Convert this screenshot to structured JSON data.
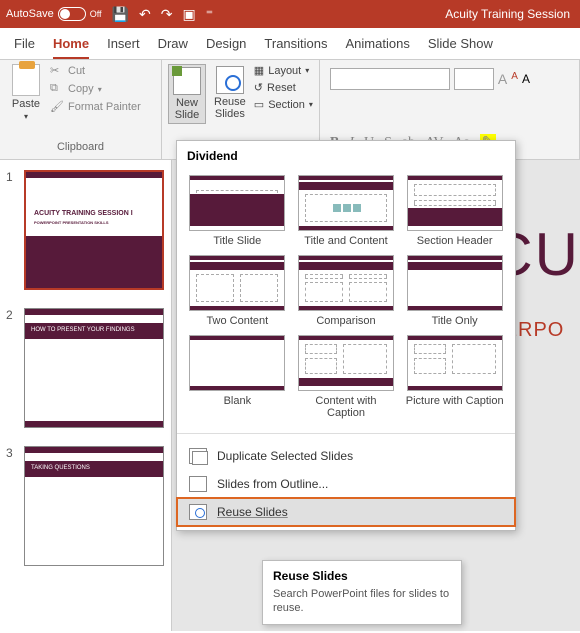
{
  "titlebar": {
    "autosave_label": "AutoSave",
    "autosave_state": "Off",
    "document_title": "Acuity Training Session"
  },
  "tabs": [
    "File",
    "Home",
    "Insert",
    "Draw",
    "Design",
    "Transitions",
    "Animations",
    "Slide Show"
  ],
  "active_tab": "Home",
  "ribbon": {
    "clipboard": {
      "paste": "Paste",
      "cut": "Cut",
      "copy": "Copy",
      "format_painter": "Format Painter",
      "group_label": "Clipboard"
    },
    "slides": {
      "new_slide": "New\nSlide",
      "reuse_slides": "Reuse\nSlides",
      "layout": "Layout",
      "reset": "Reset",
      "section": "Section"
    },
    "font": {
      "size_up": "A",
      "size_down": "A",
      "clear": "A",
      "bold": "B",
      "italic": "I",
      "underline": "U",
      "strike": "S",
      "shadow": "ab",
      "spacing": "AV",
      "case": "Aa",
      "highlight": "A"
    }
  },
  "thumbnails": [
    {
      "num": "1",
      "title": "ACUITY TRAINING SESSION I",
      "sub": "POWERPOINT PRESENTATION SKILLS"
    },
    {
      "num": "2",
      "title": "HOW TO PRESENT YOUR FINDINGS"
    },
    {
      "num": "3",
      "title": "TAKING QUESTIONS"
    }
  ],
  "canvas": {
    "big": "CU",
    "sub": "VERPO"
  },
  "dropdown": {
    "theme": "Dividend",
    "layouts": [
      "Title Slide",
      "Title and Content",
      "Section Header",
      "Two Content",
      "Comparison",
      "Title Only",
      "Blank",
      "Content with Caption",
      "Picture with Caption"
    ],
    "menu": {
      "duplicate": "Duplicate Selected Slides",
      "outline": "Slides from Outline...",
      "reuse": "Reuse Slides"
    }
  },
  "tooltip": {
    "title": "Reuse Slides",
    "body": "Search PowerPoint files for slides to reuse."
  }
}
